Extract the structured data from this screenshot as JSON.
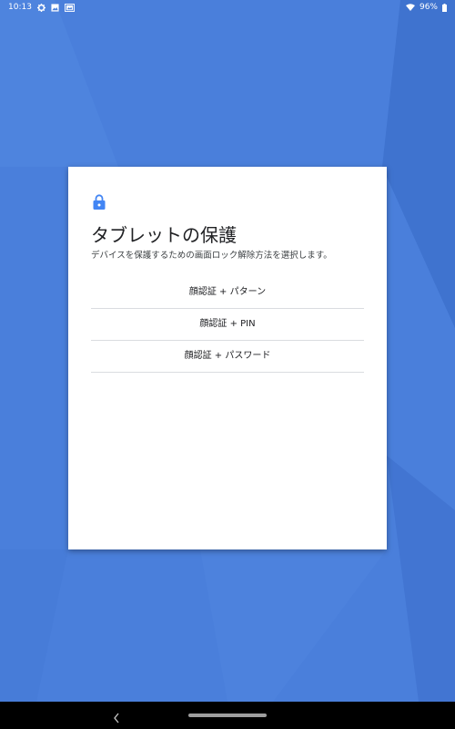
{
  "status_bar": {
    "time": "10:13",
    "icons_left": [
      "gear-icon",
      "image-icon",
      "gallery-icon"
    ],
    "battery_percent": "96%",
    "icons_right": [
      "wifi-icon",
      "battery-icon"
    ]
  },
  "dialog": {
    "icon": "lock-icon",
    "title": "タブレットの保護",
    "subtitle": "デバイスを保護するための画面ロック解除方法を選択します。",
    "options": [
      {
        "label": "顔認証 + パターン"
      },
      {
        "label": "顔認証 + PIN"
      },
      {
        "label": "顔認証 + パスワード"
      }
    ]
  },
  "nav_bar": {
    "icons": [
      "back-icon",
      "home-pill"
    ]
  },
  "colors": {
    "wallpaper": "#4a7fdb",
    "accent": "#4285f4",
    "card": "#ffffff",
    "nav_bar": "#000000"
  }
}
